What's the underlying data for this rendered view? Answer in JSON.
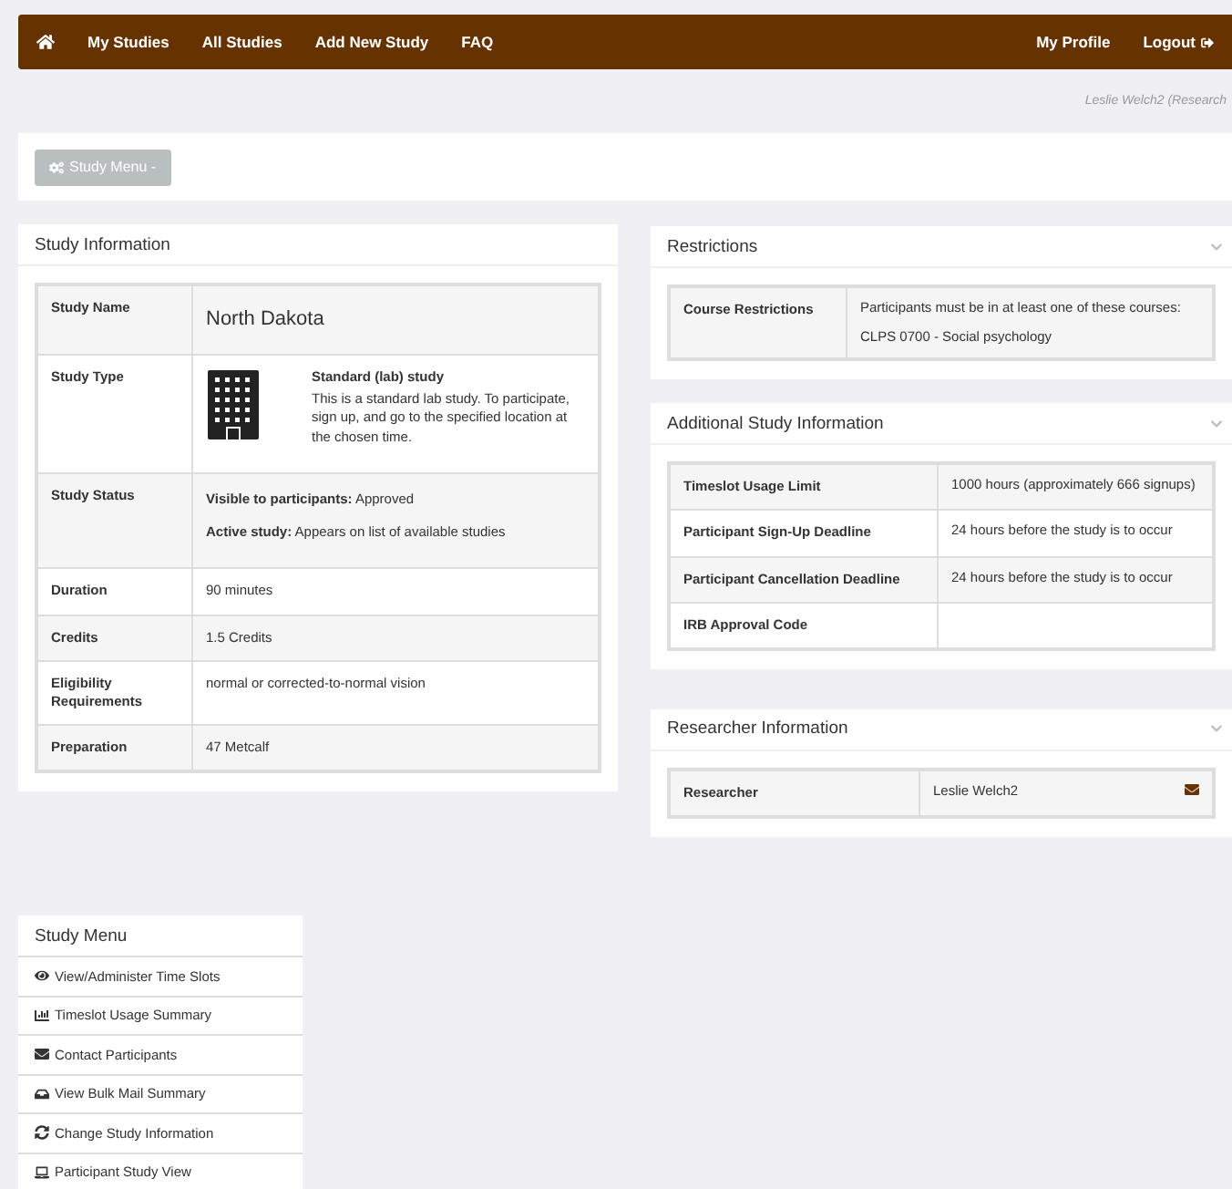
{
  "navbar": {
    "left": [
      {
        "kind": "home"
      },
      {
        "kind": "link",
        "label": "My Studies"
      },
      {
        "kind": "link",
        "label": "All Studies"
      },
      {
        "kind": "link",
        "label": "Add New Study"
      },
      {
        "kind": "link",
        "label": "FAQ"
      }
    ],
    "right": [
      {
        "kind": "link",
        "label": "My Profile"
      },
      {
        "kind": "logout",
        "label": "Logout"
      }
    ]
  },
  "user_line": "Leslie Welch2 (Research",
  "study_menu_button": "Study Menu -",
  "study_information": {
    "title": "Study Information",
    "rows": [
      {
        "kind": "name",
        "label": "Study Name",
        "value": "North Dakota"
      },
      {
        "kind": "type",
        "label": "Study Type",
        "type_title": "Standard (lab) study",
        "type_text": "This is a standard lab study. To participate, sign up, and go to the specified location at the chosen time."
      },
      {
        "kind": "status",
        "label": "Study Status",
        "lines": [
          "**Visible to participants:** Approved",
          "**Active study:** Appears on list of available studies"
        ]
      },
      {
        "kind": "text",
        "label": "Duration",
        "value": "90 minutes"
      },
      {
        "kind": "text",
        "label": "Credits",
        "value": "1.5 Credits"
      },
      {
        "kind": "text",
        "label": "Eligibility Requirements",
        "value": "normal or corrected-to-normal vision"
      },
      {
        "kind": "text",
        "label": "Preparation",
        "value": "47 Metcalf"
      }
    ]
  },
  "restrictions": {
    "title": "Restrictions",
    "rows": [
      {
        "label": "Course Restrictions",
        "lines": [
          "Participants must be in at least one of these courses:",
          "CLPS 0700 - Social psychology"
        ]
      }
    ]
  },
  "additional_information": {
    "title": "Additional Study Information",
    "rows": [
      {
        "label": "Timeslot Usage Limit",
        "lines": [
          "1000 hours (approximately 666 signups)"
        ]
      },
      {
        "label": "Participant Sign-Up Deadline",
        "lines": [
          "24 hours before the study is to occur"
        ]
      },
      {
        "label": "Participant Cancellation Deadline",
        "lines": [
          "24 hours before the study is to occur"
        ]
      },
      {
        "label": "IRB Approval Code",
        "lines": []
      }
    ]
  },
  "researcher_information": {
    "title": "Researcher Information",
    "rows": [
      {
        "label": "Researcher",
        "lines": [
          "Leslie Welch2"
        ],
        "email": true
      }
    ]
  },
  "study_menu": {
    "title": "Study Menu",
    "items": [
      {
        "kind": "eye",
        "label": "View/Administer Time Slots"
      },
      {
        "kind": "chart",
        "label": "Timeslot Usage Summary"
      },
      {
        "kind": "envelope",
        "label": "Contact Participants"
      },
      {
        "kind": "inbox",
        "label": "View Bulk Mail Summary"
      },
      {
        "kind": "refresh",
        "label": "Change Study Information"
      },
      {
        "kind": "laptop",
        "label": "Participant Study View"
      }
    ]
  }
}
